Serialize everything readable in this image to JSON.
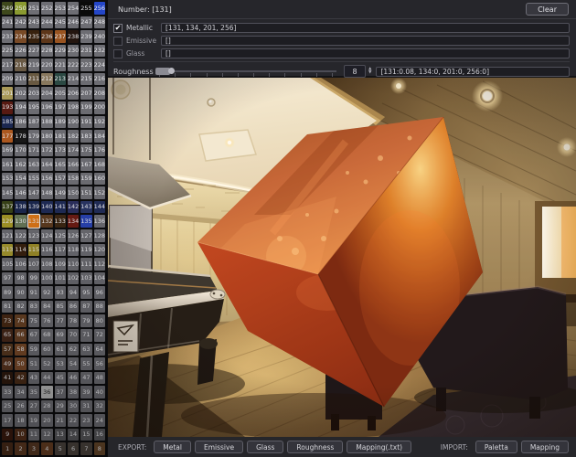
{
  "header": {
    "number_label": "Number: [131]",
    "clear_button": "Clear"
  },
  "properties": [
    {
      "name": "metallic",
      "label": "Metallic",
      "checked": true,
      "value": "[131, 134, 201, 256]"
    },
    {
      "name": "emissive",
      "label": "Emissive",
      "checked": false,
      "value": "[]"
    },
    {
      "name": "glass",
      "label": "Glass",
      "checked": false,
      "value": "[]"
    }
  ],
  "roughness": {
    "label": "Roughness",
    "spin_value": "8",
    "slider_percent": 8,
    "mapping_value": "[131:0.08, 134:0, 201:0, 256:0]"
  },
  "palette": {
    "rows": 32,
    "cols": 8,
    "min": 1,
    "max": 256,
    "numbering": "bottom row is 1-8, top row is 249-256, numbered left to right",
    "selected_number": 131,
    "default_color": "#6e6e74",
    "selected_border": "#f0f0f0",
    "light_cells": [
      36
    ],
    "cell_colors": {
      "1": "#4a2c1a",
      "2": "#5f3a22",
      "3": "#5a3a24",
      "4": "#6a4023",
      "5": "#4e4640",
      "6": "#4e4640",
      "7": "#4e4640",
      "8": "#6a4a2c",
      "9": "#3a1a0e",
      "10": "#55301a",
      "13": "#5a5a5e",
      "14": "#5a5a5e",
      "15": "#5a5a5e",
      "16": "#5a5a5e",
      "36": "#bcbcbc",
      "41": "#2e1a0e",
      "42": "#4a2c18",
      "49": "#5a3520",
      "50": "#7a4a2a",
      "57": "#5a3a20",
      "58": "#7a4a28",
      "65": "#48291a",
      "66": "#6a4226",
      "73": "#4a2a15",
      "74": "#6a4325",
      "113": "#a89a30",
      "114": "#3a2210",
      "115": "#a0902a",
      "129": "#a89a28",
      "130": "#6a7a5a",
      "131": "#e07818",
      "132": "#5e3c20",
      "133": "#3e2814",
      "134": "#6e1c14",
      "135": "#2a44b4",
      "137": "#3a4418",
      "138": "#1c2850",
      "139": "#1c2850",
      "140": "#202c58",
      "141": "#202c58",
      "142": "#2c3060",
      "143": "#2a3666",
      "144": "#222e5a",
      "177": "#b05a20",
      "178": "#191919",
      "185": "#1c2852",
      "193": "#5a1a12",
      "201": "#ac9c5a",
      "211": "#6a5a42",
      "212": "#8a7a60",
      "213": "#2c4a44",
      "218": "#6b5b46",
      "234": "#7a4a26",
      "235": "#38220f",
      "236": "#5e3619",
      "237": "#9a5420",
      "238": "#241610",
      "249": "#3e481c",
      "250": "#8a9a30",
      "255": "#0a0a0a",
      "256": "#2446c8"
    }
  },
  "footer": {
    "export_label": "EXPORT:",
    "export_buttons": [
      "Metal",
      "Emissive",
      "Glass",
      "Roughness",
      "Mapping(.txt)"
    ],
    "import_label": "IMPORT:",
    "import_buttons": [
      "Paletta",
      "Mapping"
    ]
  },
  "viewport": {
    "description": "Photographic room scene: billiard table with chrome rails at left, cream ceiling with recessed panel, stacked-stone band, wooden plank walls and sloped wood ceiling with round spotlights, bright window at right, dark sofa and rug, large glossy orange-copper cube floating corner-down in the center",
    "cube_colors": {
      "left_face": "#cf7040",
      "right_face": "#7e2a12",
      "bottom_face": "#a33318",
      "glow": "#ffb347"
    }
  }
}
